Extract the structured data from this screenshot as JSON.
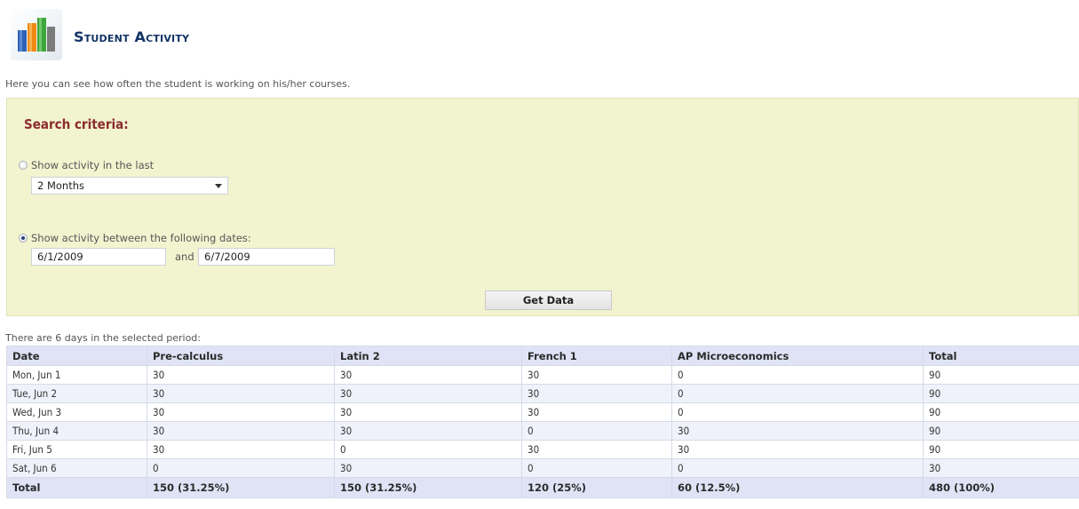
{
  "header": {
    "title": "Student Activity",
    "icon": "bar-chart-icon"
  },
  "intro_text": "Here you can see how often the student is working on his/her courses.",
  "search": {
    "heading": "Search criteria:",
    "option_last_label": "Show activity in the last",
    "option_last_checked": false,
    "period_value": "2 Months",
    "option_between_label": "Show activity between the following dates:",
    "option_between_checked": true,
    "start_date": "6/1/2009",
    "and_label": "and",
    "end_date": "6/7/2009",
    "get_data_label": "Get Data"
  },
  "results": {
    "period_text": "There are 6 days in the selected period:",
    "columns": [
      "Date",
      "Pre-calculus",
      "Latin 2",
      "French 1",
      "AP Microeconomics",
      "Total"
    ],
    "rows": [
      [
        "Mon, Jun 1",
        "30",
        "30",
        "30",
        "0",
        "90"
      ],
      [
        "Tue, Jun 2",
        "30",
        "30",
        "30",
        "0",
        "90"
      ],
      [
        "Wed, Jun 3",
        "30",
        "30",
        "30",
        "0",
        "90"
      ],
      [
        "Thu, Jun 4",
        "30",
        "30",
        "0",
        "30",
        "90"
      ],
      [
        "Fri, Jun 5",
        "30",
        "0",
        "30",
        "30",
        "90"
      ],
      [
        "Sat, Jun 6",
        "0",
        "30",
        "0",
        "0",
        "30"
      ]
    ],
    "totals": [
      "Total",
      "150 (31.25%)",
      "150 (31.25%)",
      "120 (25%)",
      "60 (12.5%)",
      "480 (100%)"
    ]
  },
  "colors": {
    "panel_background": "#f2f4d0",
    "heading_color": "#8b2b2b",
    "title_color": "#123466",
    "table_header_background": "#dfe3f5"
  }
}
